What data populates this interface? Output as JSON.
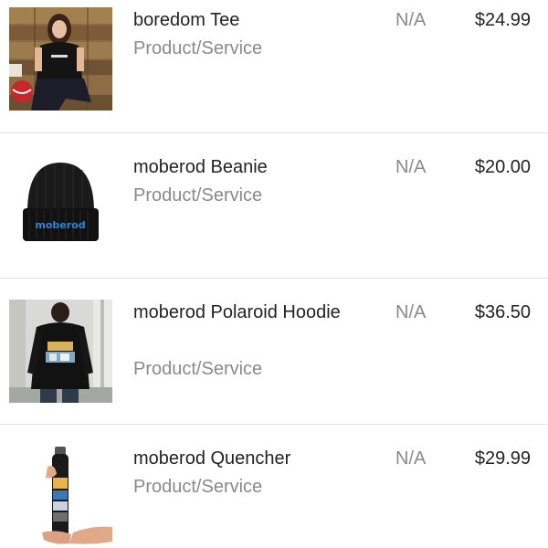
{
  "products": [
    {
      "name": "boredom Tee",
      "type": "Product/Service",
      "sku": "N/A",
      "price": "$24.99",
      "image_icon": "person-wearing-tee-photo"
    },
    {
      "name": "moberod Beanie",
      "type": "Product/Service",
      "sku": "N/A",
      "price": "$20.00",
      "image_icon": "black-beanie-photo",
      "image_text": "moberod"
    },
    {
      "name": "moberod Polaroid Hoodie",
      "type": "Product/Service",
      "sku": "N/A",
      "price": "$36.50",
      "image_icon": "person-in-hoodie-photo"
    },
    {
      "name": "moberod Quencher",
      "type": "Product/Service",
      "sku": "N/A",
      "price": "$29.99",
      "image_icon": "hand-holding-bottle-photo"
    }
  ],
  "colors": {
    "text_primary": "#222222",
    "text_secondary": "#8a8a8a",
    "divider": "#e1e1e1",
    "beanie_logo": "#2f86d6"
  }
}
